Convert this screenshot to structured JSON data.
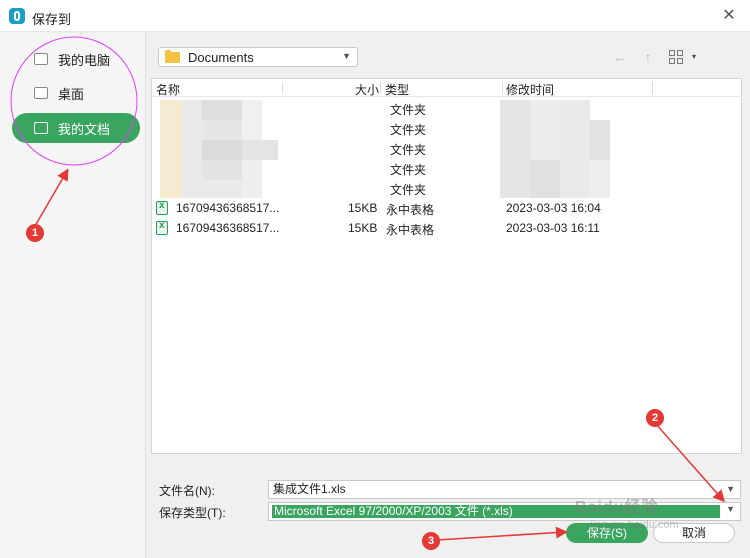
{
  "window": {
    "title": "保存到",
    "close_label": "✕"
  },
  "sidebar": {
    "items": [
      {
        "label": "我的电脑",
        "active": false
      },
      {
        "label": "桌面",
        "active": false
      },
      {
        "label": "我的文档",
        "active": true
      }
    ]
  },
  "toolbar": {
    "path": "Documents",
    "back_icon": "←",
    "up_icon": "↑",
    "view_caret": "▾"
  },
  "columns": {
    "name": "名称",
    "size": "大小",
    "type": "类型",
    "modified": "修改时间"
  },
  "folder_rows": [
    {
      "type": "文件夹"
    },
    {
      "type": "文件夹"
    },
    {
      "type": "文件夹"
    },
    {
      "type": "文件夹"
    },
    {
      "type": "文件夹"
    }
  ],
  "files": [
    {
      "name": "16709436368517...",
      "size": "15KB",
      "type": "永中表格",
      "modified": "2023-03-03 16:04"
    },
    {
      "name": "16709436368517...",
      "size": "15KB",
      "type": "永中表格",
      "modified": "2023-03-03 16:11"
    }
  ],
  "form": {
    "filename_label": "文件名(N):",
    "filename_value": "集成文件1.xls",
    "filetype_label": "保存类型(T):",
    "filetype_value": "Microsoft Excel 97/2000/XP/2003 文件 (*.xls)"
  },
  "buttons": {
    "save": "保存(S)",
    "cancel": "取消"
  },
  "annotations": {
    "badge1": "1",
    "badge2": "2",
    "badge3": "3"
  },
  "watermark": {
    "brand": "Baidu经验",
    "url": "jingyan.baidu.com"
  },
  "colors": {
    "accent": "#3aa55f",
    "annotation": "#e53935",
    "highlight_circle": "#e040fb"
  }
}
